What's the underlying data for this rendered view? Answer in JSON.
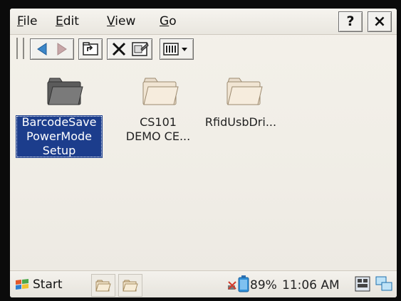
{
  "menubar": {
    "items": [
      {
        "label": "File"
      },
      {
        "label": "Edit"
      },
      {
        "label": "View"
      },
      {
        "label": "Go"
      }
    ],
    "help_label": "?",
    "close_label": "×"
  },
  "toolbar": {
    "buttons": [
      "back-icon",
      "forward-icon",
      "up-folder-icon",
      "delete-icon",
      "properties-icon",
      "view-menu-icon"
    ]
  },
  "files": [
    {
      "lines": [
        "BarcodeSave",
        "PowerMode",
        "Setup"
      ],
      "selected": true,
      "icon": "folder-dark-icon"
    },
    {
      "lines": [
        "CS101",
        "DEMO CE..."
      ],
      "selected": false,
      "icon": "folder-icon"
    },
    {
      "lines": [
        "RfidUsbDri..."
      ],
      "selected": false,
      "icon": "folder-icon"
    }
  ],
  "taskbar": {
    "start_label": "Start",
    "battery_label": "89%",
    "clock": "11:06 AM"
  },
  "colors": {
    "selection": "#1c3d8c",
    "background": "#f2efe8"
  }
}
